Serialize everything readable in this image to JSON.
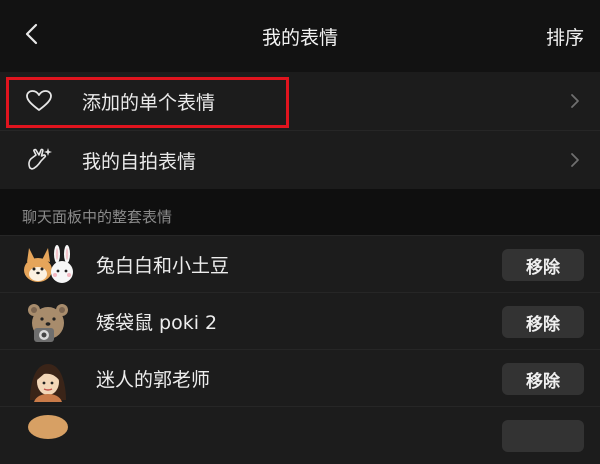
{
  "header": {
    "back_icon": "chevron-left-icon",
    "title": "我的表情",
    "sort_label": "排序"
  },
  "menu": [
    {
      "icon": "heart-outline-icon",
      "label": "添加的单个表情"
    },
    {
      "icon": "selfie-hand-sparkle-icon",
      "label": "我的自拍表情"
    }
  ],
  "section": {
    "label": "聊天面板中的整套表情"
  },
  "packs": [
    {
      "name": "兔白白和小土豆",
      "thumb": "corgi-and-rabbit-sticker",
      "action": "移除"
    },
    {
      "name": "矮袋鼠 poki 2",
      "thumb": "quokka-with-camera-sticker",
      "action": "移除"
    },
    {
      "name": "迷人的郭老师",
      "thumb": "cartoon-woman-sticker",
      "action": "移除"
    }
  ],
  "colors": {
    "highlight": "#e0141e",
    "row_bg": "#1c1c1c",
    "page_bg": "#0f0f0f",
    "button_bg": "#333333"
  }
}
